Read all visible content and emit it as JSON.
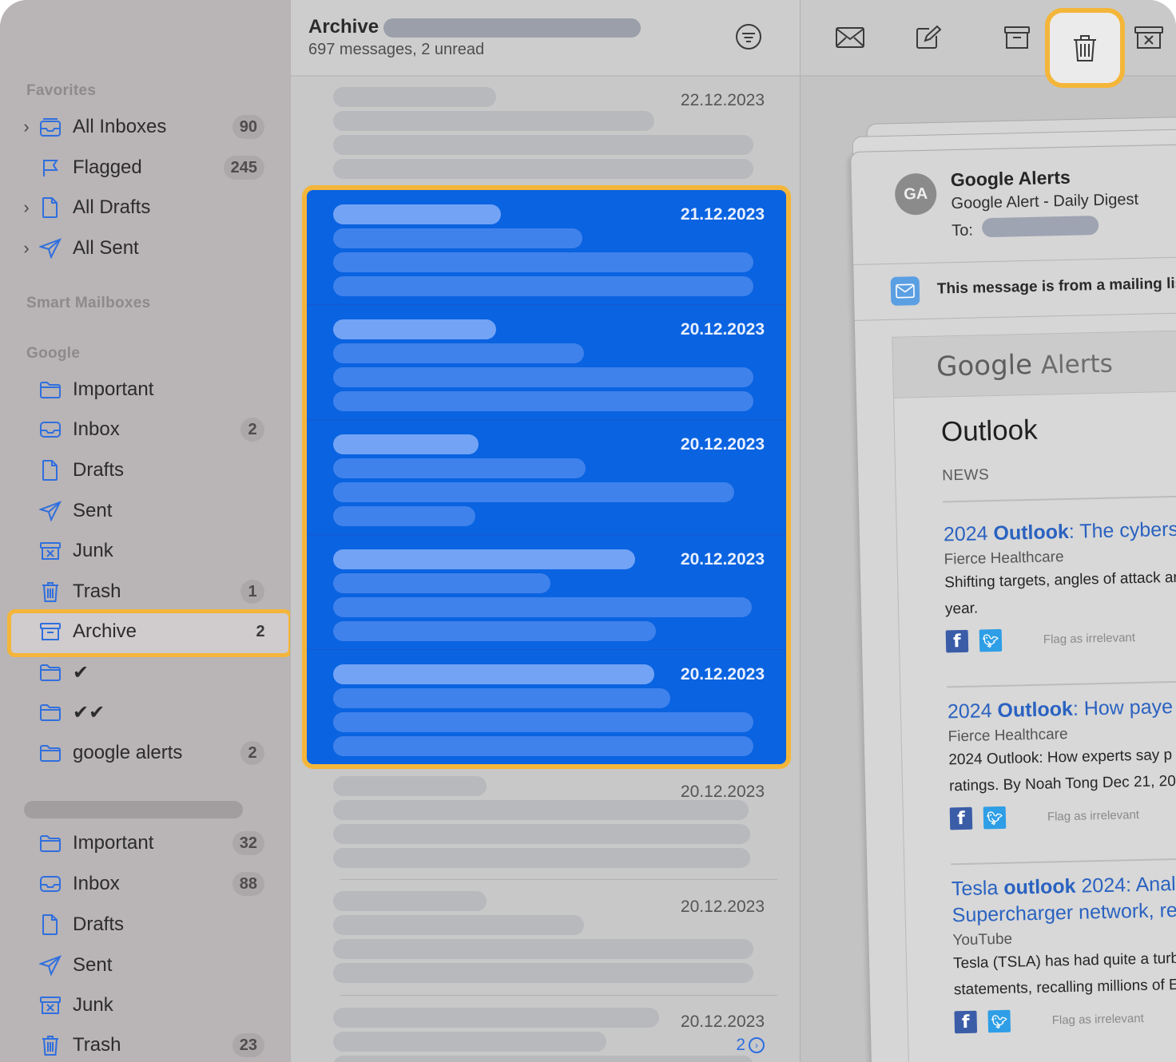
{
  "sidebar": {
    "favorites_header": "Favorites",
    "favorites": [
      {
        "label": "All Inboxes",
        "count": "90",
        "icon": "tray-stack-icon",
        "chevron": true
      },
      {
        "label": "Flagged",
        "count": "245",
        "icon": "flag-icon",
        "chevron": false
      },
      {
        "label": "All Drafts",
        "count": "",
        "icon": "document-icon",
        "chevron": true
      },
      {
        "label": "All Sent",
        "count": "",
        "icon": "paperplane-icon",
        "chevron": true
      }
    ],
    "smart_header": "Smart Mailboxes",
    "google_header": "Google",
    "google": [
      {
        "label": "Important",
        "count": "",
        "icon": "folder-icon"
      },
      {
        "label": "Inbox",
        "count": "2",
        "icon": "inbox-icon"
      },
      {
        "label": "Drafts",
        "count": "",
        "icon": "document-icon"
      },
      {
        "label": "Sent",
        "count": "",
        "icon": "paperplane-icon"
      },
      {
        "label": "Junk",
        "count": "",
        "icon": "junk-icon"
      },
      {
        "label": "Trash",
        "count": "1",
        "icon": "trash-icon"
      },
      {
        "label": "Archive",
        "count": "2",
        "icon": "archive-icon"
      },
      {
        "label": "✔",
        "count": "",
        "icon": "folder-icon"
      },
      {
        "label": "✔✔",
        "count": "",
        "icon": "folder-icon"
      },
      {
        "label": "google alerts",
        "count": "2",
        "icon": "folder-icon"
      }
    ],
    "account2": [
      {
        "label": "Important",
        "count": "32",
        "icon": "folder-icon"
      },
      {
        "label": "Inbox",
        "count": "88",
        "icon": "inbox-icon"
      },
      {
        "label": "Drafts",
        "count": "",
        "icon": "document-icon"
      },
      {
        "label": "Sent",
        "count": "",
        "icon": "paperplane-icon"
      },
      {
        "label": "Junk",
        "count": "",
        "icon": "junk-icon"
      },
      {
        "label": "Trash",
        "count": "23",
        "icon": "trash-icon"
      }
    ]
  },
  "list": {
    "title": "Archive",
    "subtitle": "697 messages, 2 unread",
    "messages_before": [
      {
        "date": "22.12.2023"
      }
    ],
    "selected": [
      {
        "date": "21.12.2023"
      },
      {
        "date": "20.12.2023"
      },
      {
        "date": "20.12.2023"
      },
      {
        "date": "20.12.2023"
      },
      {
        "date": "20.12.2023"
      }
    ],
    "messages_after": [
      {
        "date": "20.12.2023"
      },
      {
        "date": "20.12.2023"
      },
      {
        "date": "20.12.2023",
        "thread_count": "2"
      }
    ]
  },
  "toolbar": {
    "buttons": [
      "envelope-icon",
      "compose-icon",
      "archive-icon",
      "trash-icon",
      "junk-icon"
    ],
    "highlighted": "trash-icon"
  },
  "email": {
    "avatar": "GA",
    "from": "Google Alerts",
    "subject": "Google Alert - Daily Digest",
    "to_label": "To:",
    "mailing_list_note": "This message is from a mailing list",
    "logo_google": "Google",
    "logo_alerts": "Alerts",
    "heading": "Outlook",
    "section": "NEWS",
    "flag_label": "Flag as irrelevant",
    "articles": [
      {
        "title_prefix": "2024 ",
        "title_bold": "Outlook",
        "title_rest": ": The cybers",
        "source": "Fierce Healthcare",
        "desc_lines": [
          "Shifting targets, angles of attack ar",
          "year."
        ],
        "desc_bold": ""
      },
      {
        "title_prefix": "2024 ",
        "title_bold": "Outlook",
        "title_rest": ": How paye",
        "source": "Fierce Healthcare",
        "desc_lines": [
          "2024 Outlook: How experts say p",
          "ratings. By Noah Tong Dec 21, 20"
        ],
        "desc_bold": "Outlook"
      },
      {
        "title_prefix": "Tesla ",
        "title_bold": "outlook",
        "title_rest": " 2024: Anal",
        "title_line2": "Supercharger network, re",
        "source": "YouTube",
        "desc_lines": [
          "Tesla (TSLA) has had quite a turb",
          "statements, recalling millions of E"
        ],
        "desc_bold": ""
      }
    ]
  },
  "colors": {
    "selection_blue": "#0a63e0",
    "highlight_orange": "#f4b63a",
    "link_blue": "#2a62c0"
  }
}
